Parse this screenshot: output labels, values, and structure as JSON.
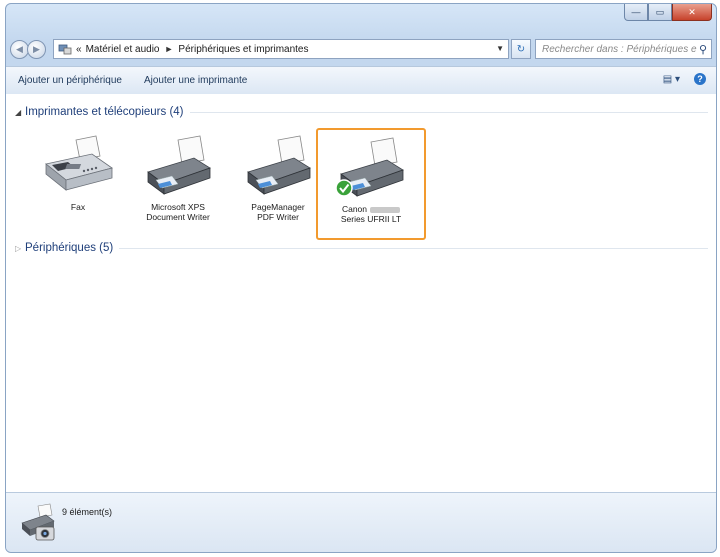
{
  "window": {
    "caption_buttons": {
      "minimize": "—",
      "maximize": "▭",
      "close": "✕"
    }
  },
  "address": {
    "overflow": "«",
    "crumbs": [
      "Matériel et audio",
      "Périphériques et imprimantes"
    ],
    "separator": "►",
    "search_placeholder": "Rechercher dans : Périphériques et im..."
  },
  "toolbar": {
    "add_device": "Ajouter un périphérique",
    "add_printer": "Ajouter une imprimante"
  },
  "groups": {
    "printers": "Imprimantes et télécopieurs (4)",
    "devices": "Périphériques (5)"
  },
  "printers": [
    {
      "line1": "Fax",
      "line2": ""
    },
    {
      "line1": "Microsoft XPS",
      "line2": "Document Writer"
    },
    {
      "line1": "PageManager",
      "line2": "PDF Writer"
    },
    {
      "line1": "Canon",
      "line2": "Series UFRII LT",
      "default": true
    }
  ],
  "status": {
    "count": "9 élément(s)"
  },
  "colors": {
    "selection": "#f29a2e",
    "group_title": "#1f3f7a",
    "default_check": "#3aa23a"
  }
}
